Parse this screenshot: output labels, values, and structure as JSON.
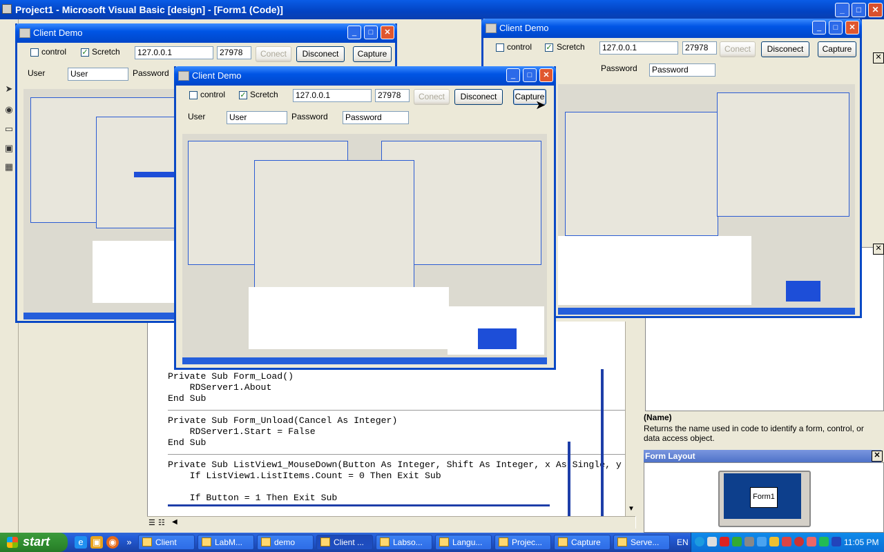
{
  "ide": {
    "title": "Project1 - Microsoft Visual Basic [design] - [Form1 (Code)]",
    "code_lines": [
      "Private Sub Form_Load()",
      "    RDServer1.About",
      "End Sub",
      "",
      "Private Sub Form_Unload(Cancel As Integer)",
      "    RDServer1.Start = False",
      "End Sub",
      "",
      "Private Sub ListView1_MouseDown(Button As Integer, Shift As Integer, x As Single, y",
      "    If ListView1.ListItems.Count = 0 Then Exit Sub",
      "",
      "    If Button = 1 Then Exit Sub"
    ],
    "properties": {
      "name_title": "(Name)",
      "description": "Returns the name used in code to identify a form, control, or data access object."
    },
    "form_layout": {
      "title": "Form Layout",
      "form_label": "Form1"
    }
  },
  "client_demo": {
    "title": "Client Demo",
    "control_label": "control",
    "control_checked": false,
    "scretch_label": "Scretch",
    "scretch_checked": true,
    "ip_value": "127.0.0.1",
    "port_value": "27978",
    "conect_label": "Conect",
    "disconect_label": "Disconect",
    "capture_label": "Capture",
    "user_label": "User",
    "user_value": "User",
    "password_label": "Password",
    "password_value": "Password"
  },
  "taskbar": {
    "start_label": "start",
    "tasks": [
      "Client",
      "LabM...",
      "demo",
      "Client ...",
      "Labso...",
      "Langu...",
      "Projec...",
      "Capture",
      "Serve..."
    ],
    "active_task_index": 3,
    "language": "EN",
    "clock": "11:05 PM"
  },
  "colors": {
    "title_blue": "#0055e5",
    "taskbar_blue": "#245edb",
    "start_green": "#2e8b2e",
    "window_face": "#ece9d8"
  }
}
